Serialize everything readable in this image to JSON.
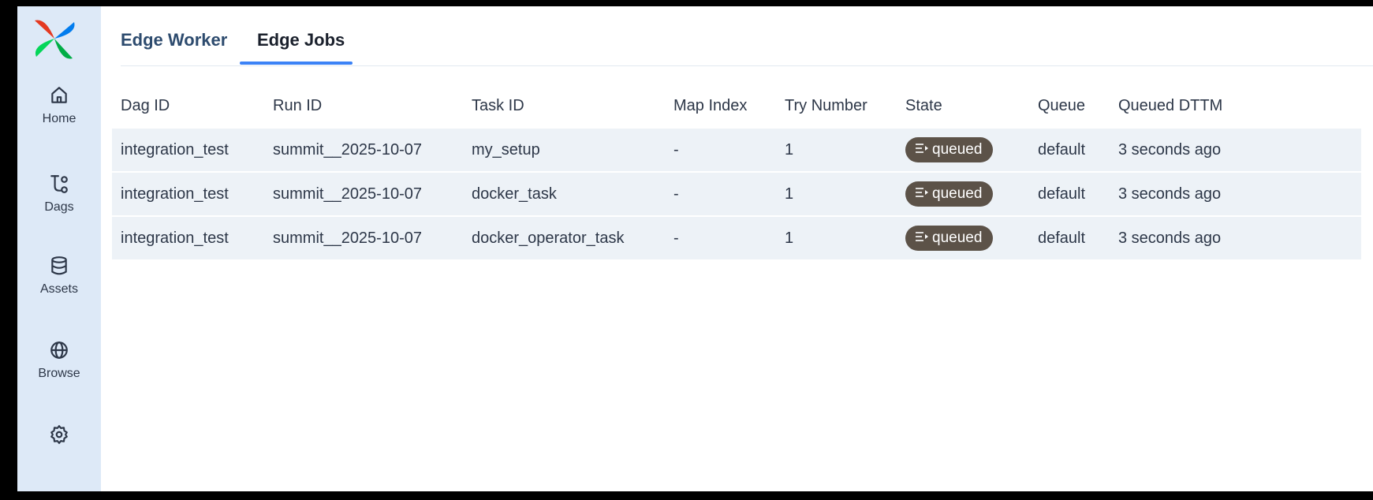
{
  "sidebar": {
    "items": [
      {
        "label": "Home",
        "icon": "home-icon"
      },
      {
        "label": "Dags",
        "icon": "dags-icon"
      },
      {
        "label": "Assets",
        "icon": "database-icon"
      },
      {
        "label": "Browse",
        "icon": "globe-icon"
      },
      {
        "label": "",
        "icon": "gear-icon"
      }
    ]
  },
  "tabs": [
    {
      "label": "Edge Worker",
      "active": false
    },
    {
      "label": "Edge Jobs",
      "active": true
    }
  ],
  "table": {
    "columns": [
      "Dag ID",
      "Run ID",
      "Task ID",
      "Map Index",
      "Try Number",
      "State",
      "Queue",
      "Queued DTTM"
    ],
    "rows": [
      [
        "integration_test",
        "summit__2025-10-07",
        "my_setup",
        "-",
        "1",
        "queued",
        "default",
        "3 seconds ago"
      ],
      [
        "integration_test",
        "summit__2025-10-07",
        "docker_task",
        "-",
        "1",
        "queued",
        "default",
        "3 seconds ago"
      ],
      [
        "integration_test",
        "summit__2025-10-07",
        "docker_operator_task",
        "-",
        "1",
        "queued",
        "default",
        "3 seconds ago"
      ]
    ]
  },
  "colors": {
    "sidebar_bg": "#dde9f7",
    "row_bg": "#edf2f7",
    "active_tab_underline": "#3b82f6",
    "queued_badge": "#5c5248"
  }
}
